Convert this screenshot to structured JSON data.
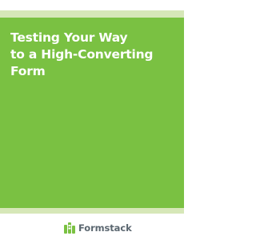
{
  "document": {
    "title_lines": [
      "Testing Your Way",
      "to a High-Converting",
      "Form"
    ],
    "publisher": "Formstack",
    "colors": {
      "panel": "#7ac142",
      "band": "#d6e7b8",
      "title_text": "#ffffff",
      "publisher_text": "#5b6770",
      "logo_icon": "#7ac142"
    },
    "logo_icon": "formstack-logo-icon"
  }
}
